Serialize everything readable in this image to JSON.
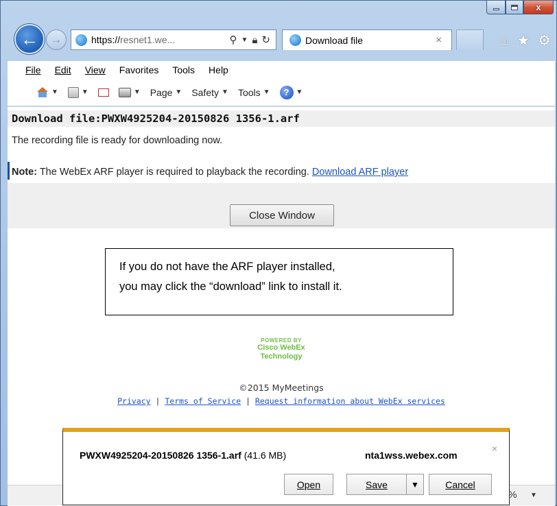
{
  "window": {
    "controls": {
      "minimize": "",
      "maximize": "",
      "close": "x"
    }
  },
  "address_bar": {
    "url_scheme": "https://",
    "url_host": "resnet1.we...",
    "search_icon": "search-icon",
    "lock_icon": "lock-icon",
    "refresh_icon": "refresh-icon"
  },
  "tab": {
    "title": "Download file",
    "close": "×"
  },
  "menu": {
    "items": [
      {
        "label": "File"
      },
      {
        "label": "Edit"
      },
      {
        "label": "View"
      },
      {
        "label": "Favorites"
      },
      {
        "label": "Tools"
      },
      {
        "label": "Help"
      }
    ]
  },
  "commandbar": {
    "page": "Page",
    "safety": "Safety",
    "tools": "Tools"
  },
  "page": {
    "download_title": "Download file:PWXW4925204-20150826 1356-1.arf",
    "ready_text": "The recording file is ready for downloading now.",
    "note_label": "Note:",
    "note_text": " The WebEx ARF player is required to playback the recording. ",
    "note_link": "Download ARF player",
    "close_button": "Close Window",
    "callout_line1": "If you do not have the ARF player installed,",
    "callout_line2": "you may click the “download” link to install it.",
    "powered_by": "POWERED BY",
    "powered_brand1": "Cisco WebEx",
    "powered_brand2": "Technology",
    "copyright": "©2015 MyMeetings",
    "footer_privacy": "Privacy",
    "footer_sep1": " | ",
    "footer_terms": "Terms of Service",
    "footer_sep2": " | ",
    "footer_request": "Request information about WebEx services"
  },
  "statusbar": {
    "zoom": "%"
  },
  "download_bar": {
    "filename": "PWXW4925204-20150826 1356-1.arf",
    "size": " (41.6 MB)",
    "host": "nta1wss.webex.com",
    "close": "×",
    "open": "Open",
    "save": "Save",
    "cancel": "Cancel",
    "accent": "#e3a11b"
  }
}
